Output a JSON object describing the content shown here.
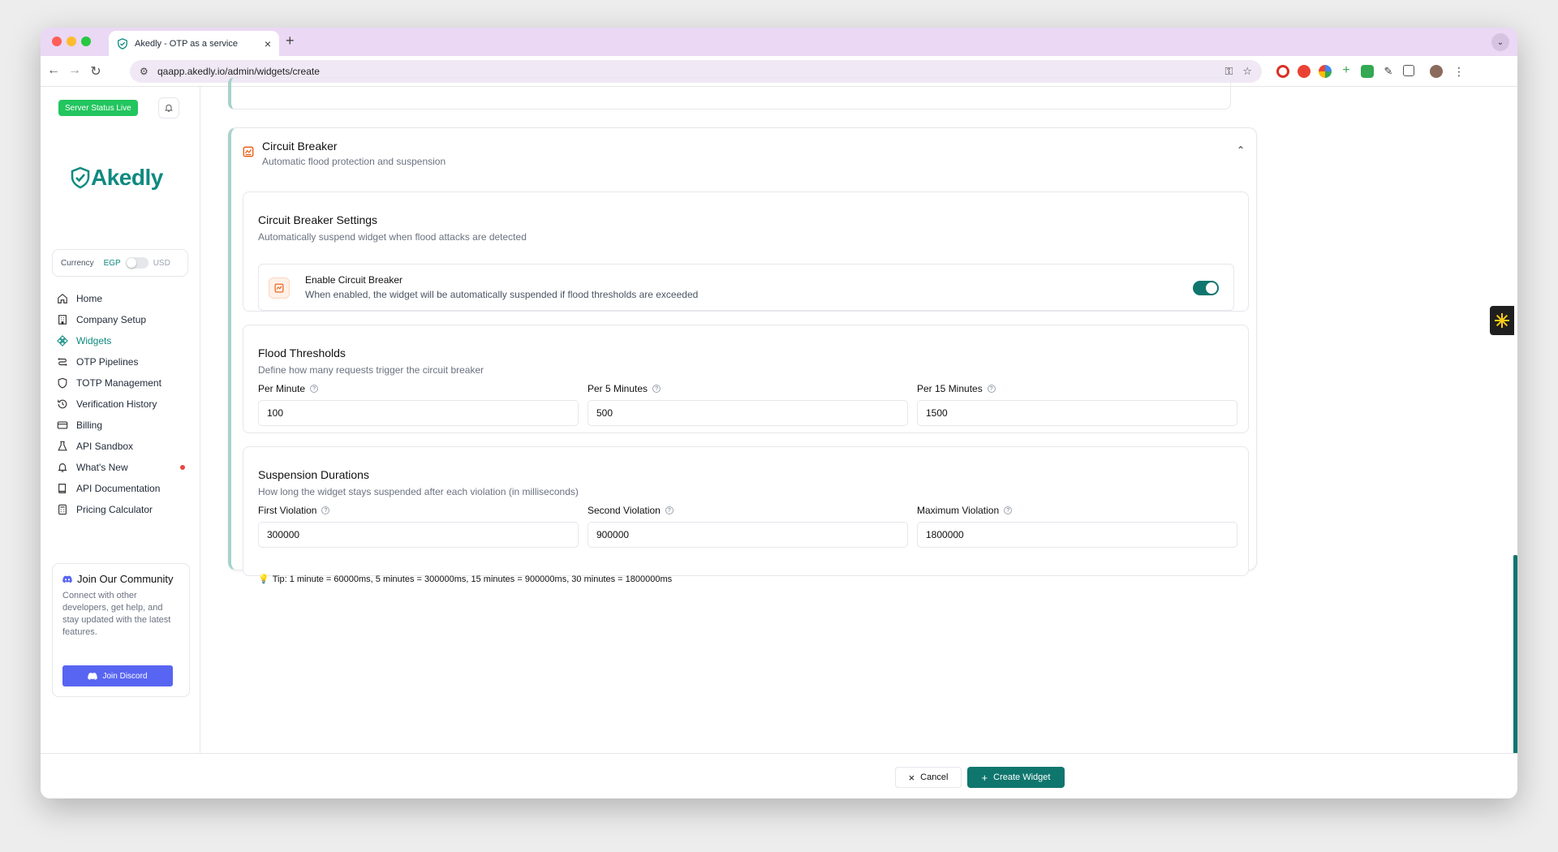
{
  "browser": {
    "tab_title": "Akedly - OTP as a service",
    "url": "qaapp.akedly.io/admin/widgets/create"
  },
  "sidebar": {
    "server_status": "Server Status Live",
    "logo_text": "Akedly",
    "currency": {
      "label": "Currency",
      "left": "EGP",
      "right": "USD"
    },
    "items": [
      {
        "label": "Home",
        "icon": "home-icon"
      },
      {
        "label": "Company Setup",
        "icon": "building-icon"
      },
      {
        "label": "Widgets",
        "icon": "widgets-icon",
        "active": true
      },
      {
        "label": "OTP Pipelines",
        "icon": "pipeline-icon"
      },
      {
        "label": "TOTP Management",
        "icon": "shield-icon"
      },
      {
        "label": "Verification History",
        "icon": "history-icon"
      },
      {
        "label": "Billing",
        "icon": "card-icon"
      },
      {
        "label": "API Sandbox",
        "icon": "flask-icon"
      },
      {
        "label": "What's New",
        "icon": "bell-icon",
        "badge": true
      },
      {
        "label": "API Documentation",
        "icon": "book-icon"
      },
      {
        "label": "Pricing Calculator",
        "icon": "calculator-icon"
      }
    ],
    "community": {
      "title": "Join Our Community",
      "description": "Connect with other developers, get help, and stay updated with the latest features.",
      "button": "Join Discord"
    }
  },
  "circuit_breaker": {
    "title": "Circuit Breaker",
    "subtitle": "Automatic flood protection and suspension",
    "settings": {
      "title": "Circuit Breaker Settings",
      "description": "Automatically suspend widget when flood attacks are detected",
      "enable_label": "Enable Circuit Breaker",
      "enable_description": "When enabled, the widget will be automatically suspended if flood thresholds are exceeded",
      "enabled": true
    },
    "flood": {
      "title": "Flood Thresholds",
      "description": "Define how many requests trigger the circuit breaker",
      "fields": [
        {
          "label": "Per Minute",
          "value": "100"
        },
        {
          "label": "Per 5 Minutes",
          "value": "500"
        },
        {
          "label": "Per 15 Minutes",
          "value": "1500"
        }
      ]
    },
    "suspension": {
      "title": "Suspension Durations",
      "description": "How long the widget stays suspended after each violation (in milliseconds)",
      "fields": [
        {
          "label": "First Violation",
          "value": "300000"
        },
        {
          "label": "Second Violation",
          "value": "900000"
        },
        {
          "label": "Maximum Violation",
          "value": "1800000"
        }
      ],
      "tip": "Tip: 1 minute = 60000ms, 5 minutes = 300000ms, 15 minutes = 900000ms, 30 minutes = 1800000ms"
    }
  },
  "footer": {
    "cancel": "Cancel",
    "create": "Create Widget"
  },
  "colors": {
    "brand": "#0f8a80",
    "primary_button": "#0f766e",
    "status_green": "#22c55e",
    "discord": "#5865f2"
  }
}
